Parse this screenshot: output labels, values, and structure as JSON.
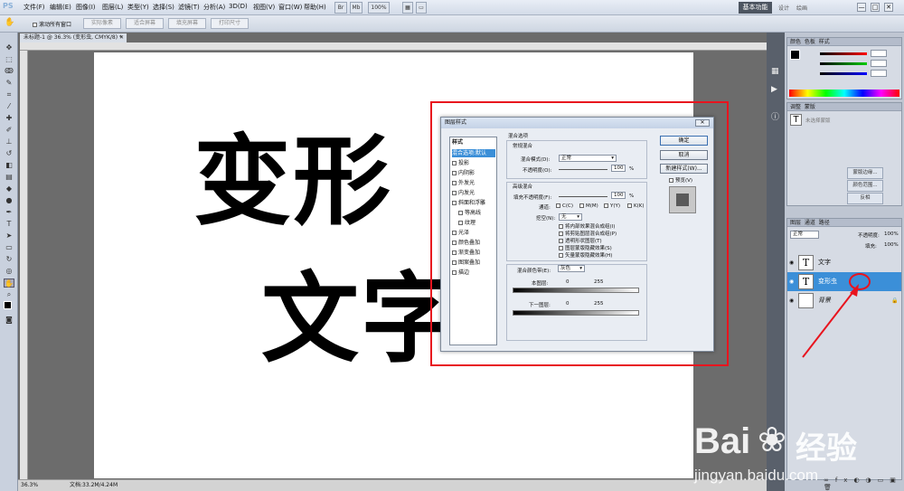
{
  "menubar": {
    "app_logo": "PS",
    "items": [
      "文件(F)",
      "编辑(E)",
      "图像(I)",
      "图层(L)",
      "类型(Y)",
      "选择(S)",
      "滤镜(T)",
      "分析(A)",
      "3D(D)",
      "视图(V)",
      "窗口(W)",
      "帮助(H)"
    ],
    "zoom": "100%",
    "workspace": "基本功能",
    "workspace_links": [
      "设计",
      "绘画"
    ],
    "window_buttons": [
      "—",
      "□",
      "✕"
    ]
  },
  "options": {
    "checkbox_label": "滚动所有窗口",
    "buttons": [
      "实际像素",
      "适合屏幕",
      "填充屏幕",
      "打印尺寸"
    ]
  },
  "document": {
    "tab_title": "未标题-1 @ 36.3% (变形虫, CMYK/8) *",
    "line1": "变形",
    "line2": "文字",
    "status_zoom": "36.3%",
    "status_doc": "文档:33.2M/4.24M"
  },
  "panels": {
    "color_tabs": [
      "颜色",
      "色板",
      "样式"
    ],
    "adjust_tabs": [
      "调整",
      "蒙版"
    ],
    "text_tool_hint": "未选择蒙版",
    "mask_buttons": [
      "蒙版边缘...",
      "颜色范围...",
      "反相"
    ],
    "layers_tabs": [
      "图层",
      "通道",
      "路径"
    ],
    "blend_mode": "正常",
    "opacity_label": "不透明度:",
    "opacity_value": "100%",
    "fill_label": "填充:",
    "fill_value": "100%",
    "layers": [
      {
        "name": "文字",
        "thumb": "T",
        "selected": false
      },
      {
        "name": "变形虫",
        "thumb": "T",
        "selected": true
      },
      {
        "name": "背景",
        "thumb": "",
        "selected": false
      }
    ]
  },
  "dialog": {
    "title": "图层样式",
    "close": "✕",
    "styles_header": "样式",
    "style_items": [
      {
        "label": "混合选项:默认",
        "active": true,
        "checkbox": false
      },
      {
        "label": "投影",
        "active": false,
        "checkbox": true
      },
      {
        "label": "内阴影",
        "active": false,
        "checkbox": true
      },
      {
        "label": "外发光",
        "active": false,
        "checkbox": true
      },
      {
        "label": "内发光",
        "active": false,
        "checkbox": true
      },
      {
        "label": "斜面和浮雕",
        "active": false,
        "checkbox": true
      },
      {
        "label": "等高线",
        "active": false,
        "checkbox": true
      },
      {
        "label": "纹理",
        "active": false,
        "checkbox": true
      },
      {
        "label": "光泽",
        "active": false,
        "checkbox": true
      },
      {
        "label": "颜色叠加",
        "active": false,
        "checkbox": true
      },
      {
        "label": "渐变叠加",
        "active": false,
        "checkbox": true
      },
      {
        "label": "图案叠加",
        "active": false,
        "checkbox": true
      },
      {
        "label": "描边",
        "active": false,
        "checkbox": true
      }
    ],
    "blend_section": "混合选项",
    "general_blend": "常规混合",
    "blend_mode_label": "混合模式(D):",
    "blend_mode_value": "正常",
    "opacity_label": "不透明度(O):",
    "opacity_value": "100",
    "pct": "%",
    "advanced_blend": "高级混合",
    "fill_opacity_label": "填充不透明度(F):",
    "fill_opacity_value": "100",
    "channels_label": "通道:",
    "channels": [
      "C(C)",
      "M(M)",
      "Y(Y)",
      "K(K)"
    ],
    "knockout_label": "挖空(N):",
    "knockout_value": "无",
    "options": [
      {
        "label": "将内部效果混合成组(I)",
        "checked": false
      },
      {
        "label": "将剪贴图层混合成组(P)",
        "checked": true
      },
      {
        "label": "透明形状图层(T)",
        "checked": true
      },
      {
        "label": "图层蒙版隐藏效果(S)",
        "checked": false
      },
      {
        "label": "矢量蒙版隐藏效果(H)",
        "checked": false
      }
    ],
    "blend_if_label": "混合颜色带(E):",
    "blend_if_value": "灰色",
    "this_layer_label": "本图层:",
    "under_layer_label": "下一图层:",
    "range_min": "0",
    "range_max": "255",
    "buttons": {
      "ok": "确定",
      "cancel": "取消",
      "new_style": "新建样式(W)...",
      "preview": "预览(V)"
    }
  },
  "watermark": {
    "brand": "Bai",
    "brand2": "经验",
    "url": "jingyan.baidu.com"
  },
  "colors": {
    "annotation_red": "#e8141e",
    "selected_layer": "#3b8fd8",
    "swatch_blue": "#3b8fd8"
  }
}
